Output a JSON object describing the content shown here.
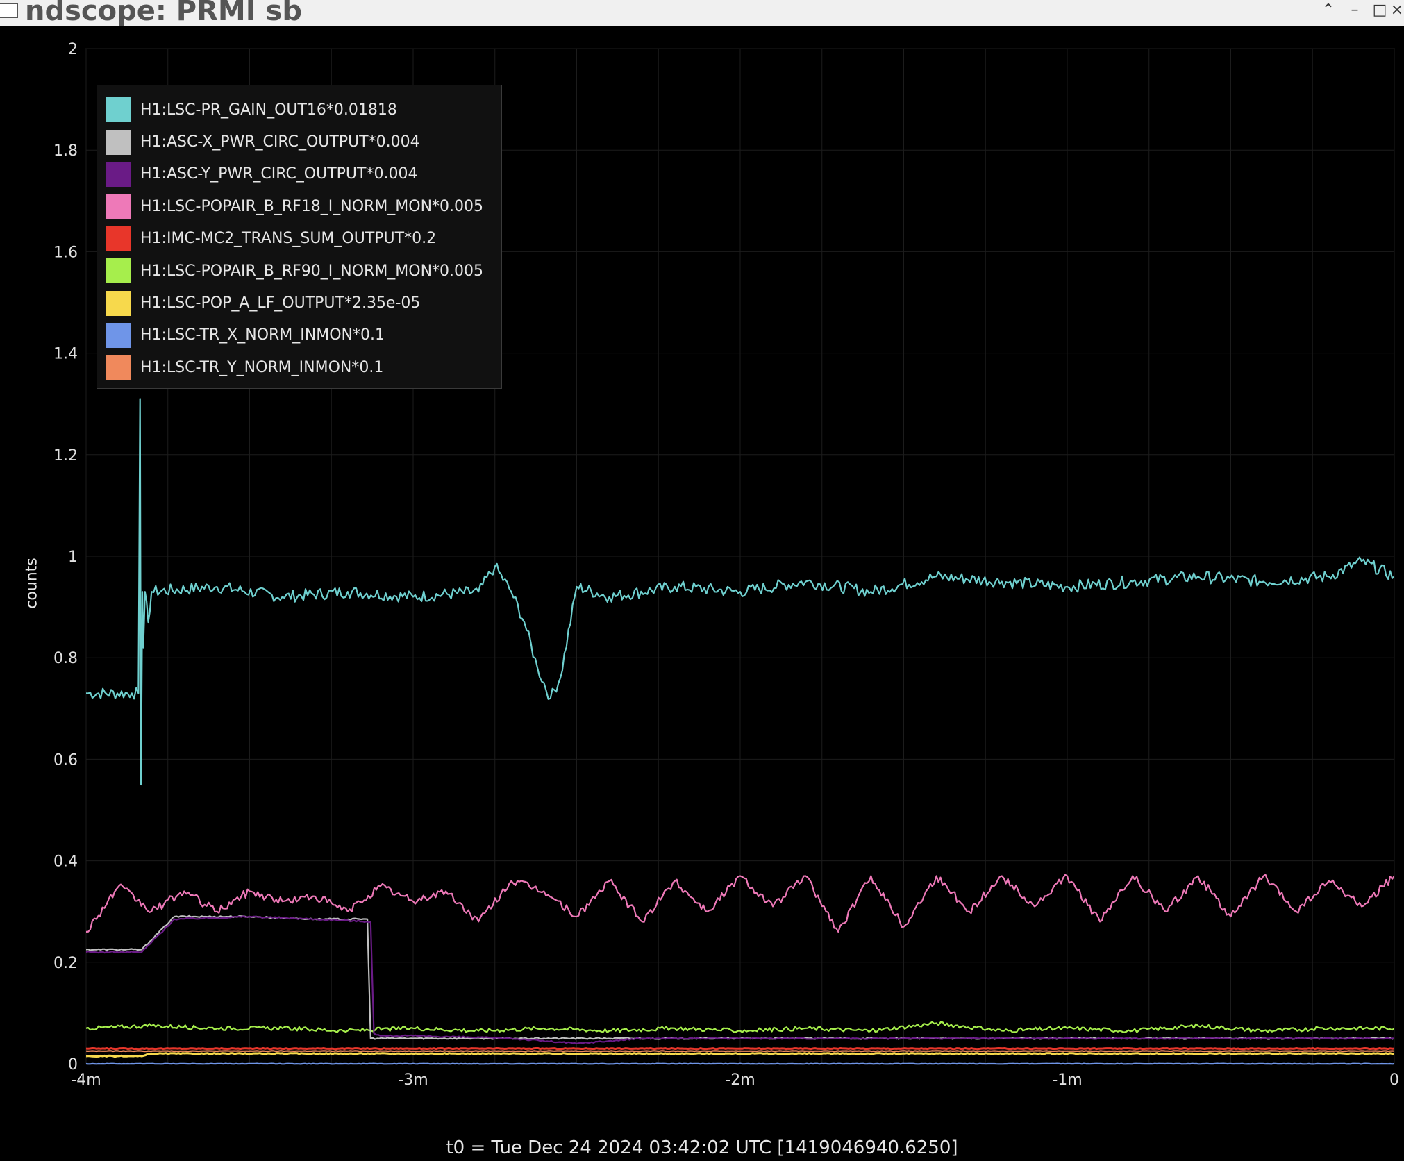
{
  "window": {
    "title": "ndscope: PRMI sb",
    "buttons": {
      "up": "⌃",
      "minimize": "–",
      "maximize": "□",
      "close": "×"
    }
  },
  "plot": {
    "ylabel": "counts",
    "yticks": [
      "0",
      "0.2",
      "0.4",
      "0.6",
      "0.8",
      "1",
      "1.2",
      "1.4",
      "1.6",
      "1.8",
      "2"
    ],
    "xticks": [
      "-4m",
      "-3m",
      "-2m",
      "-1m",
      "0"
    ],
    "t0_label": "t0 = Tue Dec 24 2024 03:42:02 UTC [1419046940.6250]",
    "grid": true,
    "background": "#000000",
    "legend_position": "top-left"
  },
  "legend": [
    {
      "name": "H1:LSC-PR_GAIN_OUT16*0.01818",
      "color": "#6fd0cf"
    },
    {
      "name": "H1:ASC-X_PWR_CIRC_OUTPUT*0.004",
      "color": "#c0c0c0"
    },
    {
      "name": "H1:ASC-Y_PWR_CIRC_OUTPUT*0.004",
      "color": "#6a1b86"
    },
    {
      "name": "H1:LSC-POPAIR_B_RF18_I_NORM_MON*0.005",
      "color": "#ee79b8"
    },
    {
      "name": "H1:IMC-MC2_TRANS_SUM_OUTPUT*0.2",
      "color": "#e8362a"
    },
    {
      "name": "H1:LSC-POPAIR_B_RF90_I_NORM_MON*0.005",
      "color": "#a6ee4c"
    },
    {
      "name": "H1:LSC-POP_A_LF_OUTPUT*2.35e-05",
      "color": "#f7d94c"
    },
    {
      "name": "H1:LSC-TR_X_NORM_INMON*0.1",
      "color": "#6f95e8"
    },
    {
      "name": "H1:LSC-TR_Y_NORM_INMON*0.1",
      "color": "#f0895c"
    }
  ],
  "chart_data": {
    "type": "line",
    "xlabel": "",
    "ylabel": "counts",
    "x_unit": "minutes",
    "xlim": [
      -4,
      0
    ],
    "ylim": [
      0,
      2
    ],
    "series": [
      {
        "name": "H1:LSC-PR_GAIN_OUT16*0.01818",
        "color": "#6fd0cf",
        "x": [
          -4,
          -3.86,
          -3.84,
          -3.835,
          -3.832,
          -3.828,
          -3.825,
          -3.82,
          -3.81,
          -3.8,
          -3.6,
          -3.4,
          -3.2,
          -3.0,
          -2.8,
          -2.75,
          -2.7,
          -2.66,
          -2.62,
          -2.58,
          -2.55,
          -2.5,
          -2.4,
          -2.2,
          -2.0,
          -1.8,
          -1.6,
          -1.4,
          -1.2,
          -1.0,
          -0.8,
          -0.6,
          -0.4,
          -0.2,
          -0.1,
          0
        ],
        "y": [
          0.73,
          0.73,
          0.73,
          1.31,
          0.55,
          0.93,
          0.82,
          0.93,
          0.87,
          0.93,
          0.94,
          0.92,
          0.93,
          0.92,
          0.93,
          0.98,
          0.93,
          0.87,
          0.78,
          0.72,
          0.76,
          0.94,
          0.92,
          0.94,
          0.93,
          0.95,
          0.93,
          0.96,
          0.95,
          0.94,
          0.95,
          0.96,
          0.95,
          0.96,
          0.99,
          0.96
        ]
      },
      {
        "name": "H1:ASC-X_PWR_CIRC_OUTPUT*0.004",
        "color": "#c0c0c0",
        "x": [
          -4,
          -3.83,
          -3.73,
          -3.5,
          -3.3,
          -3.14,
          -3.13,
          -3.11,
          -3.0,
          -2.6,
          -2.0,
          -1.0,
          0
        ],
        "y": [
          0.225,
          0.225,
          0.29,
          0.29,
          0.285,
          0.285,
          0.05,
          0.05,
          0.05,
          0.05,
          0.05,
          0.05,
          0.05
        ]
      },
      {
        "name": "H1:ASC-Y_PWR_CIRC_OUTPUT*0.004",
        "color": "#6a1b86",
        "x": [
          -4,
          -3.83,
          -3.73,
          -3.5,
          -3.3,
          -3.13,
          -3.12,
          -3.1,
          -3.0,
          -2.7,
          -2.5,
          -2.3,
          -2.0,
          -1.0,
          0
        ],
        "y": [
          0.22,
          0.22,
          0.285,
          0.29,
          0.285,
          0.28,
          0.06,
          0.055,
          0.055,
          0.05,
          0.04,
          0.05,
          0.05,
          0.05,
          0.05
        ]
      },
      {
        "name": "H1:LSC-POPAIR_B_RF18_I_NORM_MON*0.005",
        "color": "#ee79b8",
        "x": [
          -4,
          -3.9,
          -3.8,
          -3.7,
          -3.6,
          -3.5,
          -3.4,
          -3.3,
          -3.2,
          -3.1,
          -3.0,
          -2.9,
          -2.8,
          -2.7,
          -2.6,
          -2.5,
          -2.4,
          -2.3,
          -2.2,
          -2.1,
          -2.0,
          -1.9,
          -1.8,
          -1.7,
          -1.6,
          -1.5,
          -1.4,
          -1.3,
          -1.2,
          -1.1,
          -1.0,
          -0.9,
          -0.8,
          -0.7,
          -0.6,
          -0.5,
          -0.4,
          -0.3,
          -0.2,
          -0.1,
          0
        ],
        "y": [
          0.26,
          0.35,
          0.3,
          0.34,
          0.3,
          0.34,
          0.32,
          0.33,
          0.3,
          0.35,
          0.32,
          0.34,
          0.28,
          0.36,
          0.34,
          0.29,
          0.36,
          0.28,
          0.36,
          0.3,
          0.37,
          0.31,
          0.37,
          0.26,
          0.37,
          0.27,
          0.37,
          0.3,
          0.37,
          0.31,
          0.37,
          0.28,
          0.37,
          0.3,
          0.37,
          0.29,
          0.37,
          0.3,
          0.36,
          0.31,
          0.37
        ]
      },
      {
        "name": "H1:IMC-MC2_TRANS_SUM_OUTPUT*0.2",
        "color": "#e8362a",
        "x": [
          -4,
          -2,
          0
        ],
        "y": [
          0.03,
          0.03,
          0.03
        ]
      },
      {
        "name": "H1:LSC-POPAIR_B_RF90_I_NORM_MON*0.005",
        "color": "#a6ee4c",
        "x": [
          -4,
          -3.8,
          -3.6,
          -3.4,
          -3.2,
          -3.0,
          -2.8,
          -2.6,
          -2.4,
          -2.2,
          -2.0,
          -1.8,
          -1.6,
          -1.4,
          -1.2,
          -1.0,
          -0.8,
          -0.6,
          -0.4,
          -0.2,
          0
        ],
        "y": [
          0.07,
          0.075,
          0.07,
          0.07,
          0.065,
          0.07,
          0.065,
          0.07,
          0.065,
          0.07,
          0.065,
          0.07,
          0.065,
          0.08,
          0.065,
          0.07,
          0.065,
          0.075,
          0.065,
          0.07,
          0.07
        ]
      },
      {
        "name": "H1:LSC-POP_A_LF_OUTPUT*2.35e-05",
        "color": "#f7d94c",
        "x": [
          -4,
          -3.83,
          -3.8,
          -2.0,
          0
        ],
        "y": [
          0.015,
          0.015,
          0.02,
          0.02,
          0.02
        ]
      },
      {
        "name": "H1:LSC-TR_X_NORM_INMON*0.1",
        "color": "#6f95e8",
        "x": [
          -4,
          0
        ],
        "y": [
          0.0,
          0.0
        ]
      },
      {
        "name": "H1:LSC-TR_Y_NORM_INMON*0.1",
        "color": "#f0895c",
        "x": [
          -4,
          0
        ],
        "y": [
          0.025,
          0.025
        ]
      }
    ]
  }
}
